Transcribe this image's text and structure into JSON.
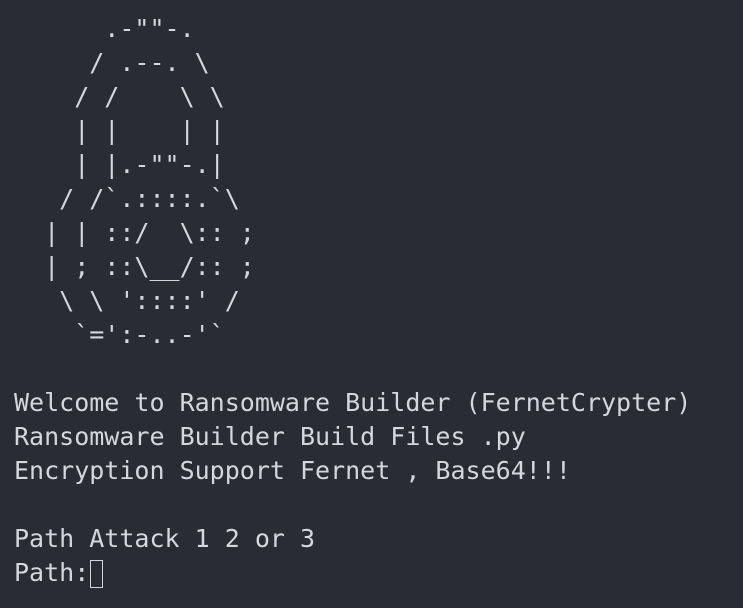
{
  "terminal": {
    "ascii_art": [
      "      .-\"\"-.",
      "     / .--. \\",
      "    / /    \\ \\",
      "    | |    | |",
      "    | |.-\"\"-.|",
      "   / /`.::::.`\\",
      "  | | ::/  \\:: ;",
      "  | ; ::\\__/:: ;",
      "   \\ \\ '::::' /",
      "    `=':-..-'`"
    ],
    "messages": [
      "Welcome to Ransomware Builder (FernetCrypter)",
      "Ransomware Builder Build Files .py",
      "Encryption Support Fernet , Base64!!!"
    ],
    "options_prompt": "Path Attack 1 2 or 3",
    "input_prompt": "Path:"
  }
}
